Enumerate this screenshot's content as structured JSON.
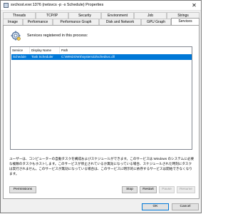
{
  "window": {
    "title": "svchost.exe:1376 (netsvcs -p -s Schedule) Properties",
    "close_glyph": "✕"
  },
  "tabs": {
    "row1": [
      "Threads",
      "TCP/IP",
      "Security",
      "Environment",
      "Job",
      "Strings"
    ],
    "row2": [
      "Image",
      "Performance",
      "Performance Graph",
      "Disk and Network",
      "GPU Graph",
      "Services"
    ],
    "active": "Services"
  },
  "services": {
    "heading": "Services registered in this process:",
    "columns": [
      "Service",
      "Display Name",
      "Path"
    ],
    "rows": [
      {
        "service": "Schedule",
        "display_name": "Task Scheduler",
        "path": "C:\\WINDOWS\\system32\\schedsvc.dll"
      }
    ],
    "description": "ユーザーは、コンピューターの自動タスクを構成およびスケジュールができます。このサービスは Windows のシステムに必要な複数のタスクもホストします。このサービスが停止されているか無効になっている場合、スケジュールされた時刻にタスクは実行されません。このサービスが無効になっている場合は、このサービスに明示的に依存するサービスは開始できなくなります。"
  },
  "buttons": {
    "permissions": "Permissions",
    "stop": "Stop",
    "restart": "Restart",
    "pause": "Pause",
    "resume": "Resume",
    "ok": "OK",
    "cancel": "Cancel"
  },
  "colors": {
    "selection": "#0078d7",
    "window_bg": "#f0f0f0",
    "panel_bg": "#ffffff"
  }
}
